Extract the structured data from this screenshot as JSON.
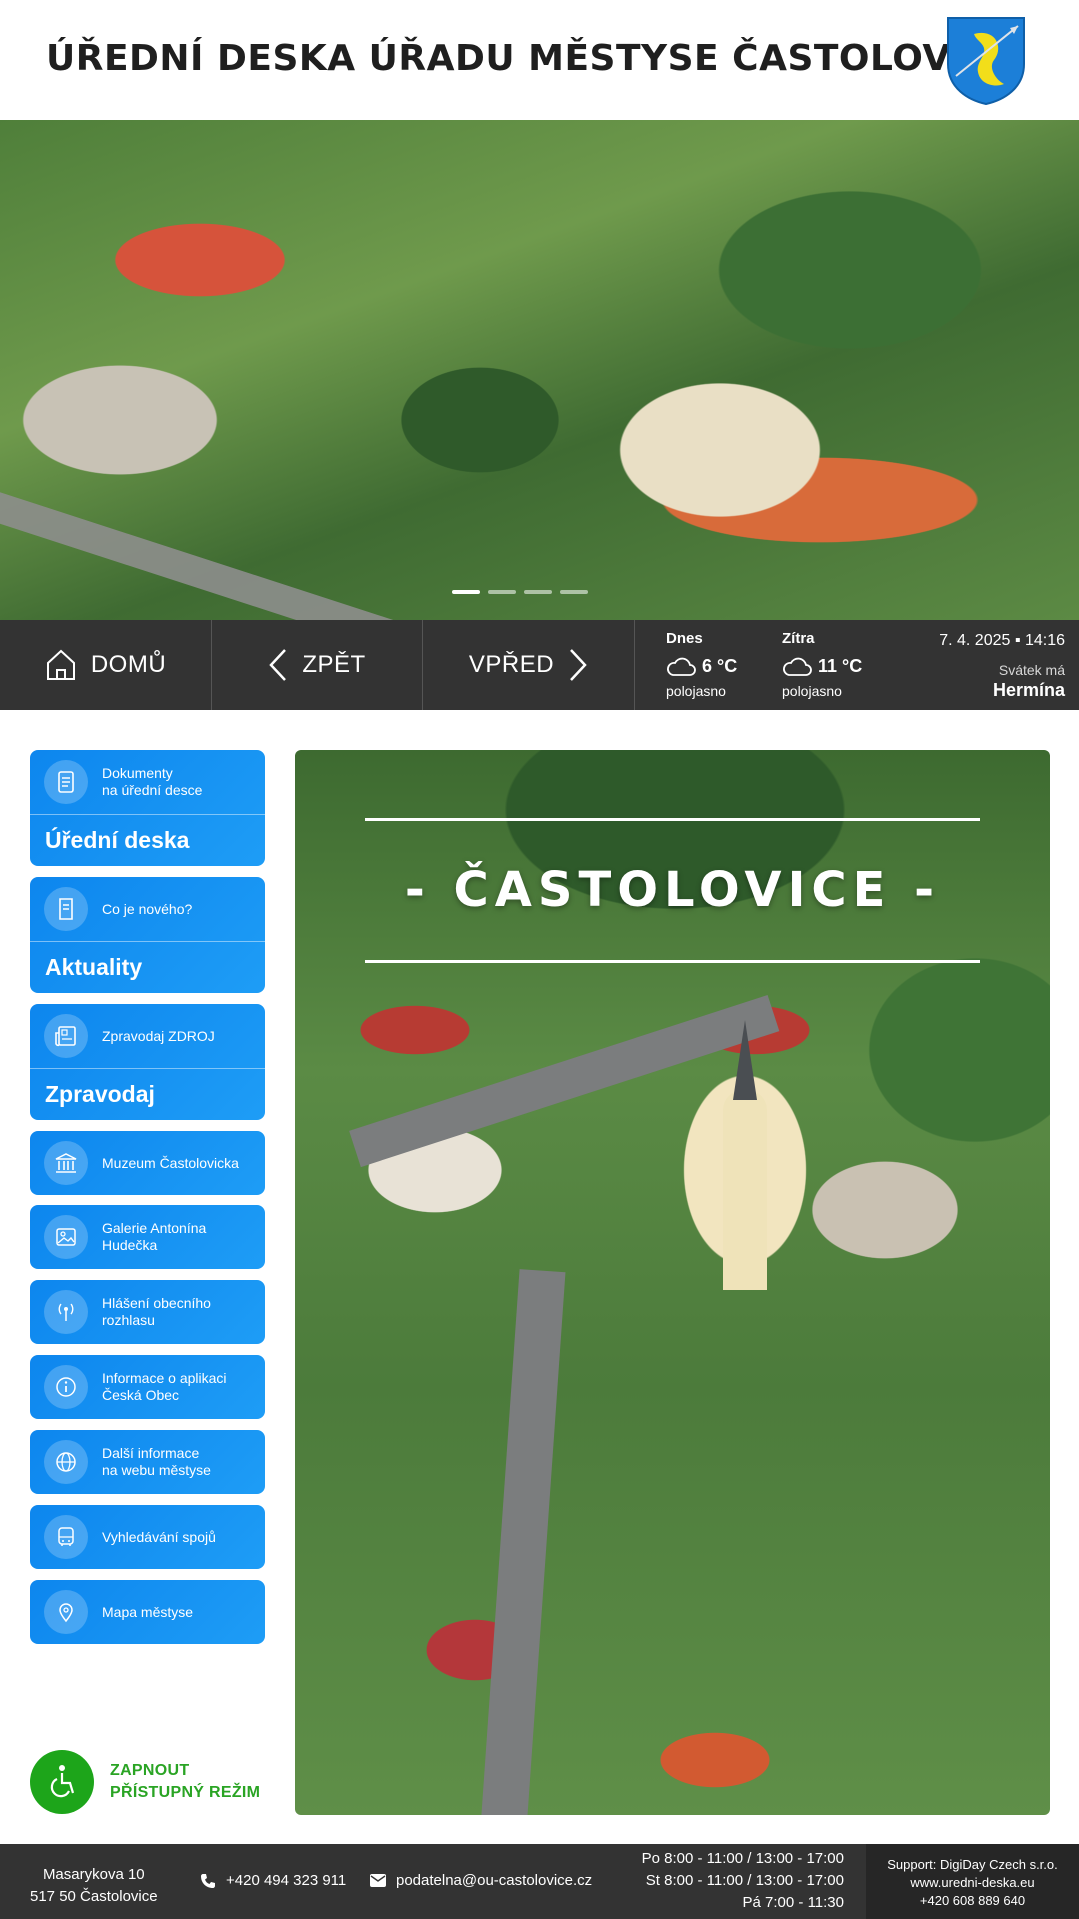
{
  "header": {
    "title": "ÚŘEDNÍ DESKA ÚŘADU MĚSTYSE ČASTOLOVICE",
    "crest_icon": "fish-crest-icon"
  },
  "hero": {
    "slides": 4,
    "active_slide": 0
  },
  "navbar": {
    "home_label": "DOMŮ",
    "back_label": "ZPĚT",
    "forward_label": "VPŘED",
    "weather": {
      "today": {
        "day": "Dnes",
        "temp": "6 °C",
        "desc": "polojasno",
        "icon": "cloud-icon"
      },
      "tomorrow": {
        "day": "Zítra",
        "temp": "11 °C",
        "desc": "polojasno",
        "icon": "cloud-icon"
      }
    },
    "datetime": "7. 4. 2025 ▪ 14:16",
    "nameday_label": "Svátek má",
    "nameday_name": "Hermína"
  },
  "sidebar": {
    "items": [
      {
        "text": "Dokumenty na úřední desce",
        "line1": "Dokumenty",
        "line2": "na úřední desce",
        "big": "Úřední deska",
        "icon": "document-icon"
      },
      {
        "text": "Co je nového?",
        "line1": "Co je nového?",
        "line2": "",
        "big": "Aktuality",
        "icon": "note-icon"
      },
      {
        "text": "Zpravodaj ZDROJ",
        "line1": "Zpravodaj ZDROJ",
        "line2": "",
        "big": "Zpravodaj",
        "icon": "newspaper-icon"
      },
      {
        "line1": "Muzeum Častolovicka",
        "line2": "",
        "icon": "museum-icon"
      },
      {
        "line1": "Galerie Antonína",
        "line2": "Hudečka",
        "icon": "image-icon"
      },
      {
        "line1": "Hlášení obecního",
        "line2": "rozhlasu",
        "icon": "broadcast-icon"
      },
      {
        "line1": "Informace o aplikaci",
        "line2": "Česká Obec",
        "icon": "info-icon"
      },
      {
        "line1": "Další informace",
        "line2": "na webu městyse",
        "icon": "globe-icon"
      },
      {
        "line1": "Vyhledávání spojů",
        "line2": "",
        "icon": "bus-icon"
      },
      {
        "line1": "Mapa městyse",
        "line2": "",
        "icon": "map-pin-icon"
      }
    ]
  },
  "accessibility": {
    "line1": "ZAPNOUT",
    "line2": "PŘÍSTUPNÝ REŽIM",
    "icon": "wheelchair-icon"
  },
  "main": {
    "title": "- ČASTOLOVICE -"
  },
  "footer": {
    "address_line1": "Masarykova 10",
    "address_line2": "517 50 Častolovice",
    "phone": "+420 494 323 911",
    "email": "podatelna@ou-castolovice.cz",
    "hours": [
      "Po 8:00 - 11:00 / 13:00 - 17:00",
      "St 8:00 - 11:00 / 13:00 - 17:00",
      "Pá 7:00 - 11:30"
    ],
    "support_line1": "Support: DigiDay Czech s.r.o.",
    "support_line2": "www.uredni-deska.eu",
    "support_line3": "+420 608 889 640"
  },
  "colors": {
    "accent_blue": "#0d86ee",
    "nav_dark": "#333333",
    "access_green": "#1da51a"
  }
}
